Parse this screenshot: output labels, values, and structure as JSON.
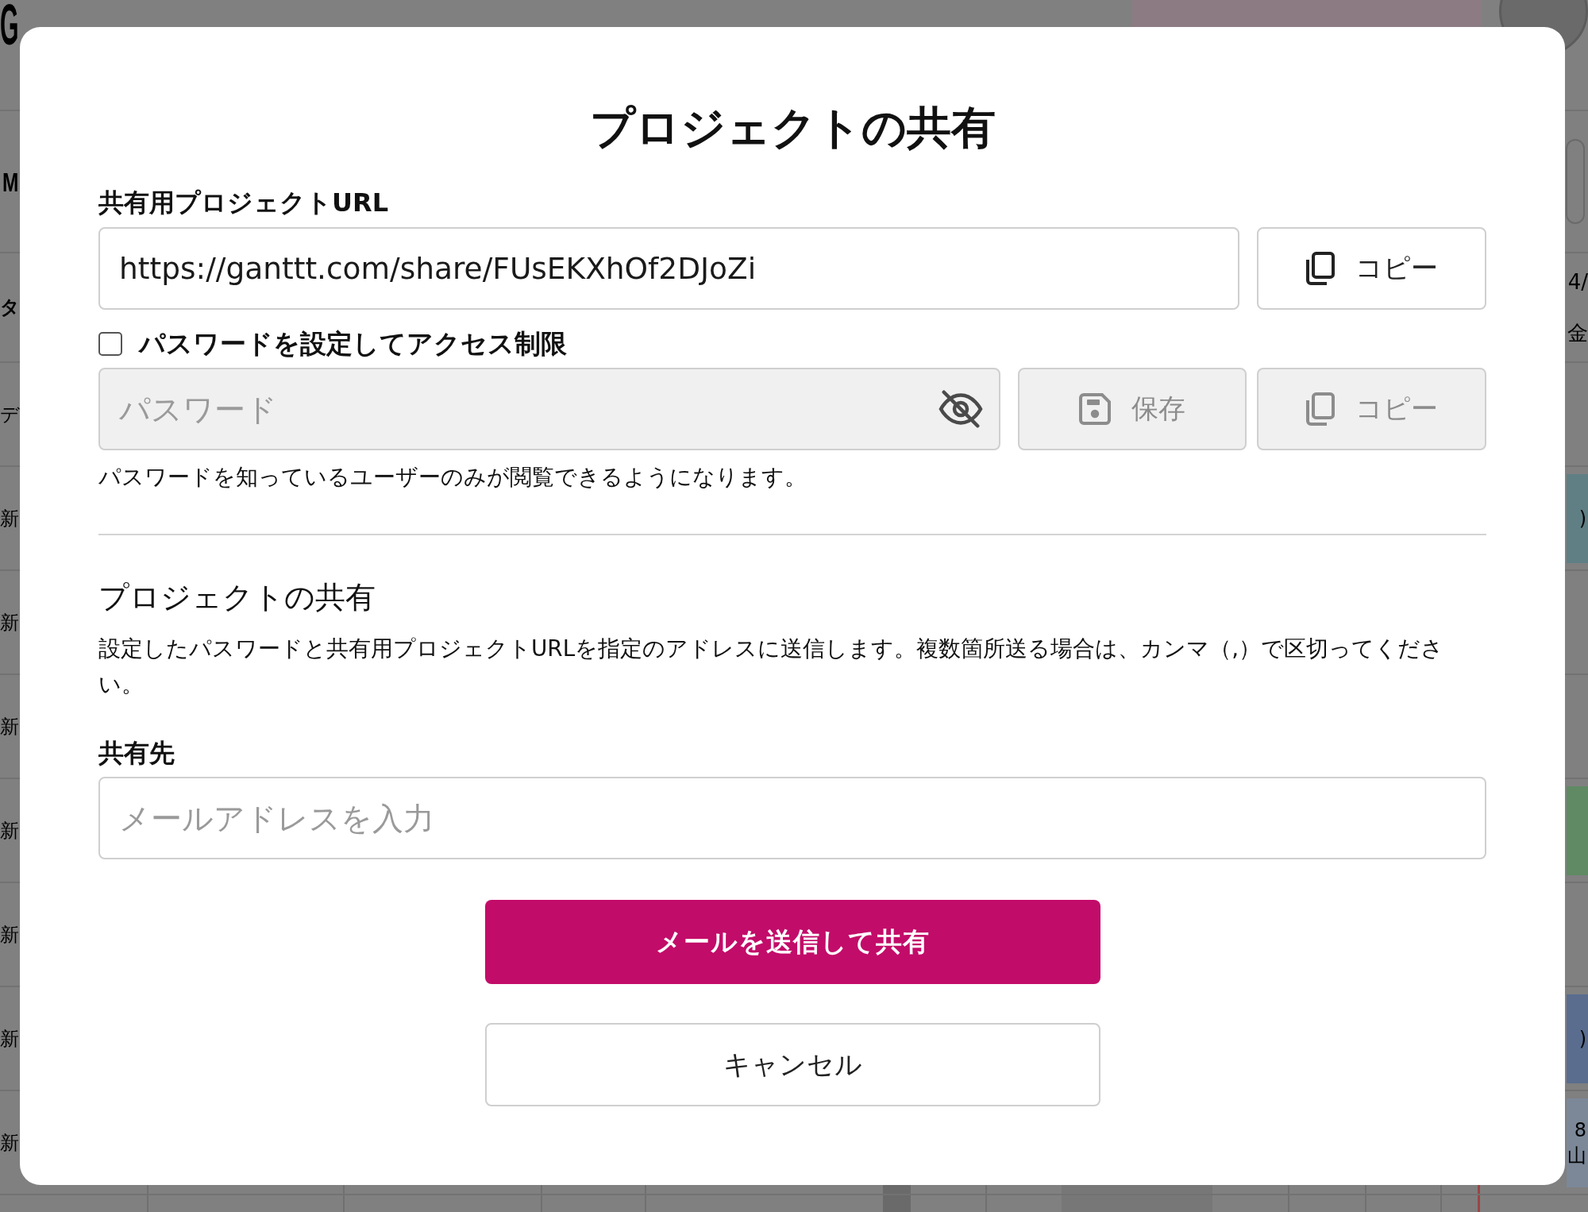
{
  "background_app": {
    "header": {
      "logo": "G"
    },
    "toolbar": {
      "project_name": "M"
    },
    "rows": [
      {
        "kind": "header",
        "label": "タ",
        "dates": [
          "4/",
          "金"
        ]
      },
      {
        "kind": "task",
        "label": "デ"
      },
      {
        "kind": "task",
        "label": "新",
        "bar": {
          "lines": [
            ")"
          ],
          "color": "#5f7f84"
        }
      },
      {
        "kind": "task",
        "label": "新"
      },
      {
        "kind": "task",
        "label": "新"
      },
      {
        "kind": "task",
        "label": "新",
        "bar": {
          "color": "#5f8a63"
        }
      },
      {
        "kind": "task",
        "label": "新"
      },
      {
        "kind": "task",
        "label": "新",
        "bar": {
          "lines": [
            ")"
          ],
          "color": "#5a6d8f"
        }
      },
      {
        "kind": "task",
        "label": "新",
        "bar": {
          "lines": [
            "8",
            "山"
          ],
          "color": "#7c8898"
        }
      }
    ]
  },
  "dialog": {
    "title": "プロジェクトの共有",
    "url_section": {
      "label": "共有用プロジェクトURL",
      "value": "https://ganttt.com/share/FUsEKXhOf2DJoZi",
      "copy_button": {
        "label": "コピー",
        "disabled": false
      }
    },
    "password_section": {
      "checkbox": {
        "label": "パスワードを設定してアクセス制限",
        "checked": false
      },
      "field": {
        "placeholder": "パスワード",
        "disabled": true
      },
      "save_button": {
        "label": "保存",
        "disabled": true
      },
      "copy_button": {
        "label": "コピー",
        "disabled": true
      },
      "help_text": "パスワードを知っているユーザーのみが閲覧できるようになります。"
    },
    "email_section": {
      "heading": "プロジェクトの共有",
      "description": "設定したパスワードと共有用プロジェクトURLを指定のアドレスに送信します。複数箇所送る場合は、カンマ（,）で区切ってください。",
      "label": "共有先",
      "field": {
        "placeholder": "メールアドレスを入力"
      }
    },
    "buttons": [
      {
        "kind": "primary",
        "label": "メールを送信して共有"
      },
      {
        "kind": "secondary",
        "label": "キャンセル"
      }
    ]
  }
}
